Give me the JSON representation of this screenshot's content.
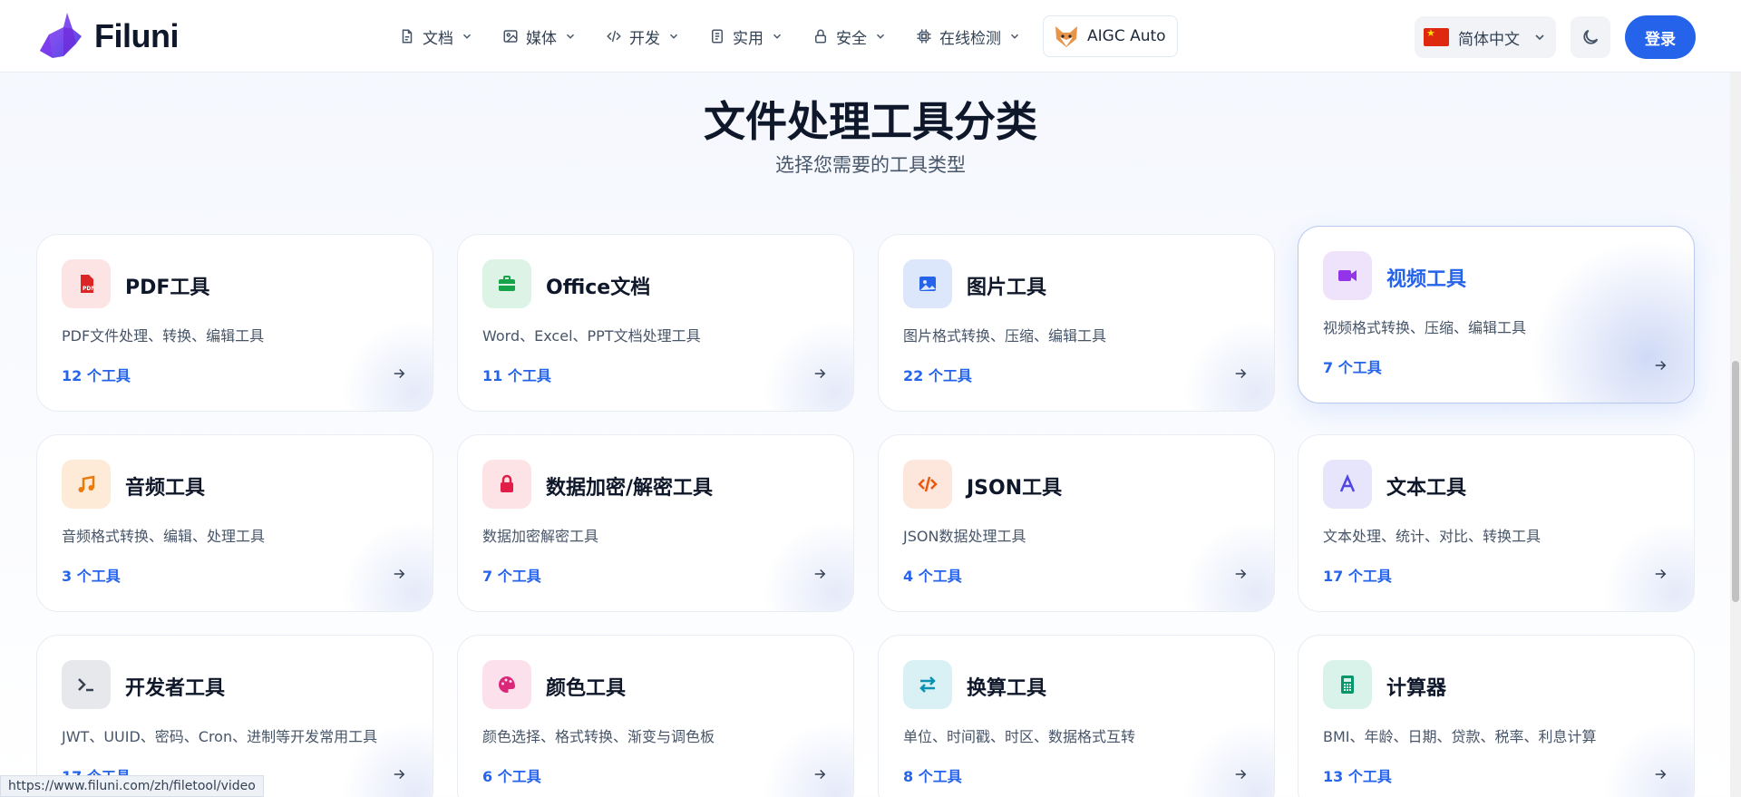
{
  "brand": {
    "name": "Filuni"
  },
  "nav": {
    "items": [
      {
        "label": "文档",
        "icon": "document-icon"
      },
      {
        "label": "媒体",
        "icon": "image-icon"
      },
      {
        "label": "开发",
        "icon": "code-icon"
      },
      {
        "label": "实用",
        "icon": "clipboard-icon"
      },
      {
        "label": "安全",
        "icon": "lock-icon"
      },
      {
        "label": "在线检测",
        "icon": "chip-icon"
      }
    ],
    "aigc_label": "AIGC Auto",
    "language": "简体中文",
    "login_label": "登录"
  },
  "section": {
    "title": "文件处理工具分类",
    "subtitle": "选择您需要的工具类型"
  },
  "cards": [
    {
      "title": "PDF工具",
      "desc": "PDF文件处理、转换、编辑工具",
      "count": "12 个工具",
      "icon": "pdf-icon",
      "icon_bg": "#fde4e4",
      "icon_color": "#dc2626"
    },
    {
      "title": "Office文档",
      "desc": "Word、Excel、PPT文档处理工具",
      "count": "11 个工具",
      "icon": "briefcase-icon",
      "icon_bg": "#dcf3e5",
      "icon_color": "#16a34a"
    },
    {
      "title": "图片工具",
      "desc": "图片格式转换、压缩、编辑工具",
      "count": "22 个工具",
      "icon": "image-icon",
      "icon_bg": "#dde7fb",
      "icon_color": "#2563eb"
    },
    {
      "title": "视频工具",
      "desc": "视频格式转换、压缩、编辑工具",
      "count": "7 个工具",
      "icon": "video-icon",
      "icon_bg": "#efe3fb",
      "icon_color": "#9333ea"
    },
    {
      "title": "音频工具",
      "desc": "音频格式转换、编辑、处理工具",
      "count": "3 个工具",
      "icon": "music-icon",
      "icon_bg": "#fdebd8",
      "icon_color": "#ea7a0c"
    },
    {
      "title": "数据加密/解密工具",
      "desc": "数据加密解密工具",
      "count": "7 个工具",
      "icon": "lock-icon",
      "icon_bg": "#fde2e6",
      "icon_color": "#e11d48"
    },
    {
      "title": "JSON工具",
      "desc": "JSON数据处理工具",
      "count": "4 个工具",
      "icon": "code-icon",
      "icon_bg": "#fde7dc",
      "icon_color": "#ea580c"
    },
    {
      "title": "文本工具",
      "desc": "文本处理、统计、对比、转换工具",
      "count": "17 个工具",
      "icon": "text-icon",
      "icon_bg": "#e6e5fb",
      "icon_color": "#4f46e5"
    },
    {
      "title": "开发者工具",
      "desc": "JWT、UUID、密码、Cron、进制等开发常用工具",
      "count": "17 个工具",
      "icon": "terminal-icon",
      "icon_bg": "#e6e8ec",
      "icon_color": "#374151"
    },
    {
      "title": "颜色工具",
      "desc": "颜色选择、格式转换、渐变与调色板",
      "count": "6 个工具",
      "icon": "palette-icon",
      "icon_bg": "#fce1ec",
      "icon_color": "#db2777"
    },
    {
      "title": "换算工具",
      "desc": "单位、时间戳、时区、数据格式互转",
      "count": "8 个工具",
      "icon": "swap-icon",
      "icon_bg": "#d9f1f4",
      "icon_color": "#0891b2"
    },
    {
      "title": "计算器",
      "desc": "BMI、年龄、日期、贷款、税率、利息计算",
      "count": "13 个工具",
      "icon": "calculator-icon",
      "icon_bg": "#d9f2ea",
      "icon_color": "#059669"
    }
  ],
  "status_url": "https://www.filuni.com/zh/filetool/video",
  "colors": {
    "accent": "#2563eb",
    "title": "#0f172a",
    "muted": "#475569"
  }
}
